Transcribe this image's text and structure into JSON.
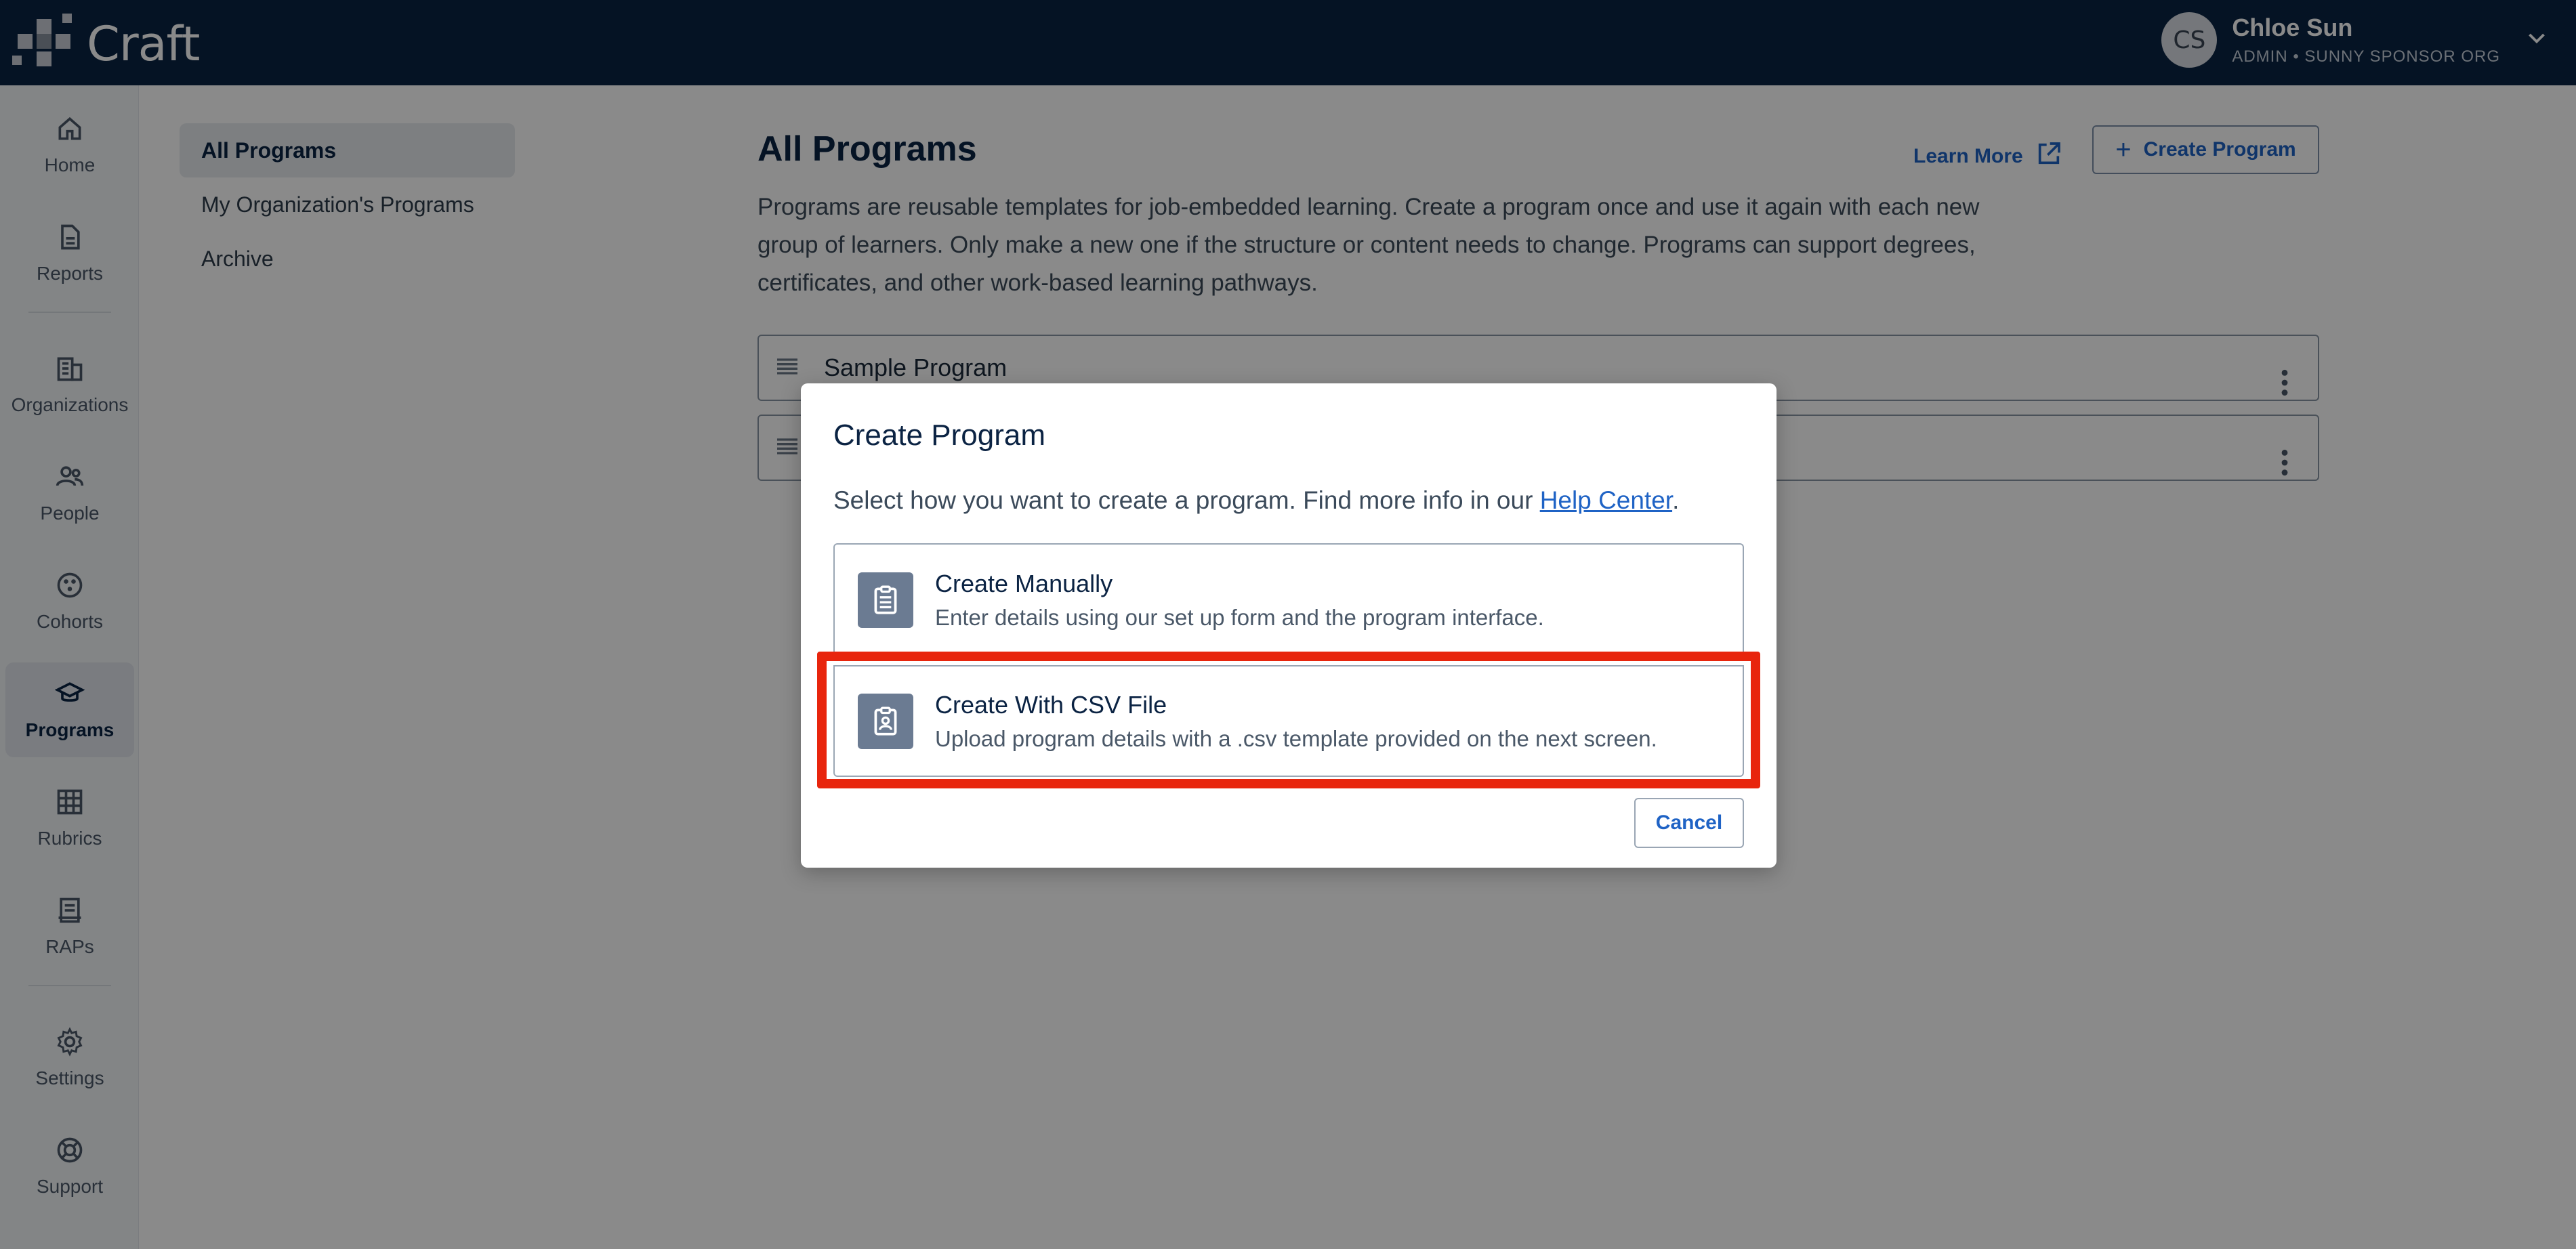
{
  "app": {
    "logo_text": "Craft"
  },
  "user": {
    "initials": "CS",
    "name": "Chloe Sun",
    "role": "ADMIN • SUNNY SPONSOR ORG"
  },
  "nav": {
    "items": [
      {
        "label": "Home",
        "icon": "home-icon"
      },
      {
        "label": "Reports",
        "icon": "document-icon"
      },
      {
        "label": "Organizations",
        "icon": "building-icon"
      },
      {
        "label": "People",
        "icon": "people-icon"
      },
      {
        "label": "Cohorts",
        "icon": "cohorts-icon"
      },
      {
        "label": "Programs",
        "icon": "graduation-cap-icon",
        "active": true
      },
      {
        "label": "Rubrics",
        "icon": "grid-icon"
      },
      {
        "label": "RAPs",
        "icon": "rap-document-icon"
      },
      {
        "label": "Settings",
        "icon": "gear-icon"
      },
      {
        "label": "Support",
        "icon": "lifebuoy-icon"
      }
    ]
  },
  "subnav": {
    "items": [
      {
        "label": "All Programs",
        "active": true
      },
      {
        "label": "My Organization's Programs"
      },
      {
        "label": "Archive"
      }
    ]
  },
  "main": {
    "title": "All Programs",
    "learn_more": "Learn More",
    "create_button": "Create Program",
    "description": "Programs are reusable templates for job-embedded learning. Create a program once and use it again with each new group of learners. Only make a new one if the structure or content needs to change. Programs can support degrees, certificates, and other work-based learning pathways.",
    "programs": [
      {
        "name": "Sample Program"
      },
      {
        "name": ""
      }
    ]
  },
  "modal": {
    "title": "Create Program",
    "desc_prefix": "Select how you want to create a program. Find more info in our ",
    "help_link": "Help Center",
    "desc_suffix": ".",
    "options": [
      {
        "title": "Create Manually",
        "subtitle": "Enter details using our set up form and the program interface.",
        "icon": "clipboard-icon"
      },
      {
        "title": "Create With CSV File",
        "subtitle": "Upload program details with a .csv template provided on the next screen.",
        "icon": "clipboard-user-icon"
      }
    ],
    "cancel": "Cancel"
  },
  "colors": {
    "topbar": "#0b2343",
    "accent": "#1f63c5",
    "highlight": "#e8250d",
    "option_icon_bg": "#6b7b92"
  }
}
